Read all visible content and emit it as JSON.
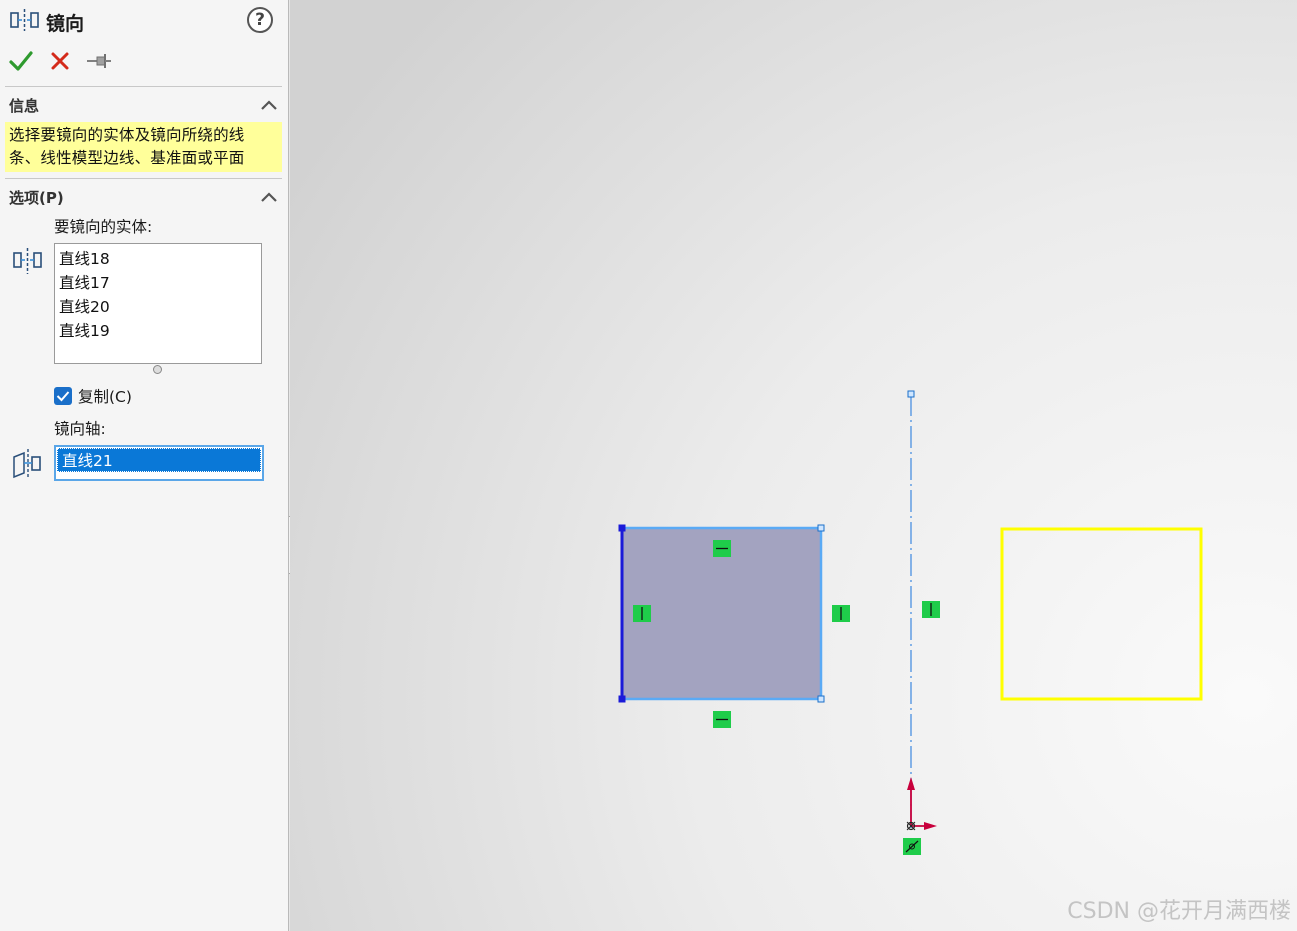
{
  "feature": {
    "title": "镜向",
    "icon": "mirror-entities-icon",
    "help_label": "?"
  },
  "actions": [
    {
      "name": "ok-button",
      "icon": "check-icon",
      "color": "#2e9a2e"
    },
    {
      "name": "cancel-button",
      "icon": "close-icon",
      "color": "#d42a1a"
    },
    {
      "name": "pin-button",
      "icon": "pushpin-icon",
      "color": "#808080"
    }
  ],
  "info_section": {
    "title": "信息",
    "message_line1": "选择要镜向的实体及镜向所绕的线",
    "message_line2": "条、线性模型边线、基准面或平面",
    "highlight_color": "#ffff9a"
  },
  "options_section": {
    "title": "选项(P)",
    "entities_label": "要镜向的实体:",
    "entities": [
      "直线18",
      "直线17",
      "直线20",
      "直线19"
    ],
    "copy_checkbox": {
      "label": "复制(C)",
      "checked": true
    },
    "axis_label": "镜向轴:",
    "axis_value": "直线21"
  },
  "canvas": {
    "selected_color": "#a3a3c0",
    "mirror_preview_color": "#ffff00",
    "relation_color": "#1fcc4a",
    "centerline_color": "#4a90e2"
  },
  "watermark": "CSDN @花开月满西楼"
}
